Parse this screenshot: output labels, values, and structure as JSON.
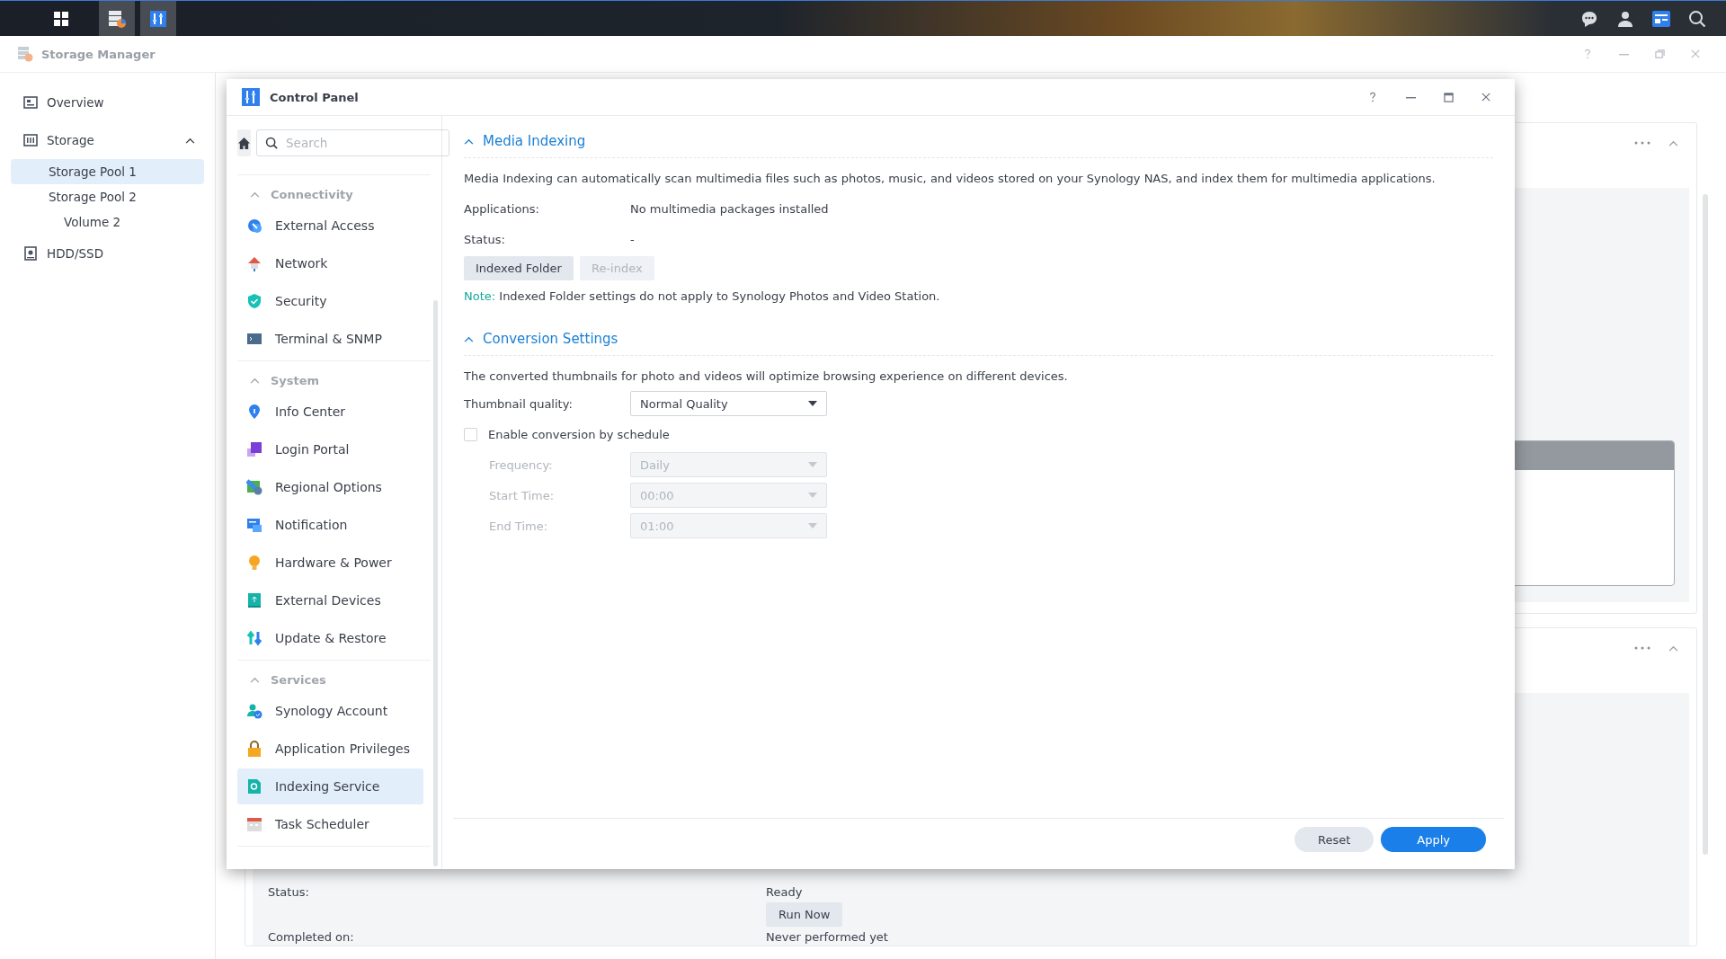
{
  "storage_manager": {
    "title": "Storage Manager",
    "sidebar": [
      {
        "label": "Overview",
        "selected": false
      },
      {
        "label": "Storage",
        "selected": false,
        "expanded": true,
        "children": [
          {
            "label": "Storage Pool 1",
            "selected": true
          },
          {
            "label": "Storage Pool 2",
            "selected": false,
            "children": [
              {
                "label": "Volume 2",
                "selected": false
              }
            ]
          }
        ]
      },
      {
        "label": "HDD/SSD",
        "selected": false
      }
    ],
    "task_details": [
      {
        "kind": "field",
        "label": "Status:",
        "value": "Ready"
      },
      {
        "kind": "button",
        "label": "Run Now"
      },
      {
        "kind": "field",
        "label": "Completed on:",
        "value": "Never performed yet"
      }
    ]
  },
  "control_panel": {
    "title": "Control Panel",
    "search": {
      "placeholder": "Search"
    },
    "sidebar": [
      {
        "title": "Connectivity",
        "expanded": true,
        "items": [
          {
            "label": "External Access",
            "selected": false
          },
          {
            "label": "Network",
            "selected": false
          },
          {
            "label": "Security",
            "selected": false
          },
          {
            "label": "Terminal & SNMP",
            "selected": false
          }
        ]
      },
      {
        "title": "System",
        "expanded": true,
        "items": [
          {
            "label": "Info Center",
            "selected": false
          },
          {
            "label": "Login Portal",
            "selected": false
          },
          {
            "label": "Regional Options",
            "selected": false
          },
          {
            "label": "Notification",
            "selected": false
          },
          {
            "label": "Hardware & Power",
            "selected": false
          },
          {
            "label": "External Devices",
            "selected": false
          },
          {
            "label": "Update & Restore",
            "selected": false
          }
        ]
      },
      {
        "title": "Services",
        "expanded": true,
        "items": [
          {
            "label": "Synology Account",
            "selected": false
          },
          {
            "label": "Application Privileges",
            "selected": false
          },
          {
            "label": "Indexing Service",
            "selected": true
          },
          {
            "label": "Task Scheduler",
            "selected": false
          }
        ]
      }
    ],
    "media_indexing": {
      "title": "Media Indexing",
      "expanded": true,
      "description": "Media Indexing can automatically scan multimedia files such as photos, music, and videos stored on your Synology NAS, and index them for multimedia applications.",
      "fields": [
        {
          "label": "Applications:",
          "value": "No multimedia packages installed"
        },
        {
          "label": "Status:",
          "value": "-"
        }
      ],
      "buttons": [
        {
          "label": "Indexed Folder",
          "disabled": false
        },
        {
          "label": "Re-index",
          "disabled": true
        }
      ],
      "note": {
        "label": "Note:",
        "text": "Indexed Folder settings do not apply to Synology Photos and Video Station."
      }
    },
    "conversion_settings": {
      "title": "Conversion Settings",
      "expanded": true,
      "description": "The converted thumbnails for photo and videos will optimize browsing experience on different devices.",
      "thumbnail_quality": {
        "label": "Thumbnail quality:",
        "value": "Normal Quality",
        "disabled": false
      },
      "schedule": {
        "label": "Enable conversion by schedule",
        "checked": false
      },
      "schedule_fields": [
        {
          "label": "Frequency:",
          "value": "Daily",
          "disabled": true
        },
        {
          "label": "Start Time:",
          "value": "00:00",
          "disabled": true
        },
        {
          "label": "End Time:",
          "value": "01:00",
          "disabled": true
        }
      ]
    },
    "footer_buttons": [
      {
        "label": "Reset",
        "kind": "secondary"
      },
      {
        "label": "Apply",
        "kind": "primary"
      }
    ]
  }
}
